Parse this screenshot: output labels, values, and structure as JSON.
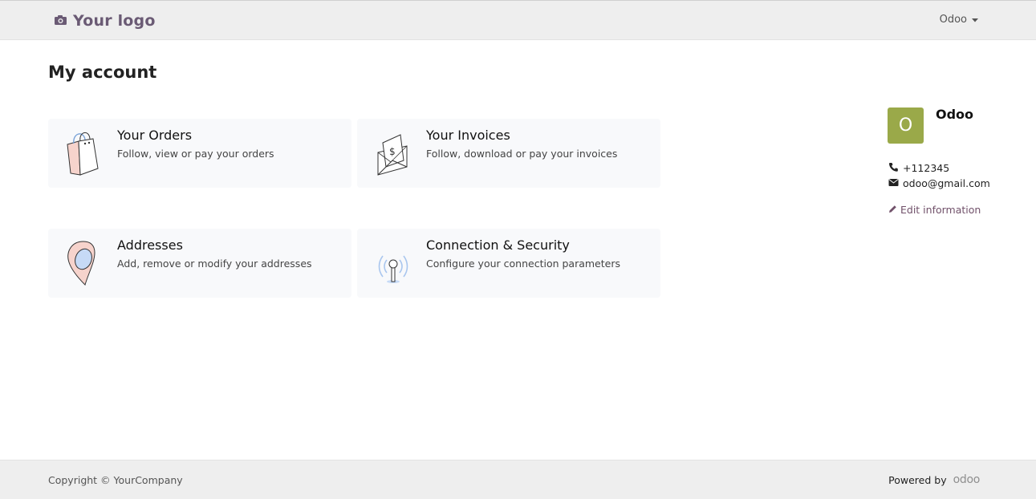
{
  "header": {
    "logo_text": "Your logo",
    "logo_icon": "camera-icon",
    "user_menu_label": "Odoo",
    "user_menu_icon": "caret-down-icon"
  },
  "page": {
    "title": "My account"
  },
  "cards": [
    {
      "title": "Your Orders",
      "description": "Follow, view or pay your orders",
      "icon": "shopping-bag-icon"
    },
    {
      "title": "Your Invoices",
      "description": "Follow, download or pay your invoices",
      "icon": "invoice-envelope-icon"
    },
    {
      "title": "Addresses",
      "description": "Add, remove or modify your addresses",
      "icon": "map-pin-icon"
    },
    {
      "title": "Connection & Security",
      "description": "Configure your connection parameters",
      "icon": "antenna-icon"
    }
  ],
  "profile": {
    "avatar_letter": "O",
    "avatar_color": "#9aa949",
    "name": "Odoo",
    "phone": "+112345",
    "email": "odoo@gmail.com",
    "edit_label": "Edit information"
  },
  "footer": {
    "copyright": "Copyright © YourCompany",
    "powered_by": "Powered by",
    "brand": "odoo"
  },
  "colors": {
    "accent": "#71516a",
    "bar_background": "#eeeeee",
    "card_background": "#f8f9fb"
  }
}
